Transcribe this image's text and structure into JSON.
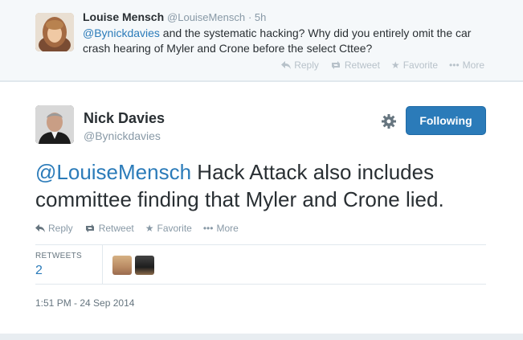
{
  "reply_tweet": {
    "name": "Louise Mensch",
    "handle": "@LouiseMensch",
    "time": "· 5h",
    "mention": "@Bynickdavies",
    "text": " and the systematic hacking? Why did you entirely omit the car crash hearing of Myler and Crone before the select Cttee?",
    "actions": {
      "reply": "Reply",
      "retweet": "Retweet",
      "favorite": "Favorite",
      "more": "More"
    }
  },
  "main_tweet": {
    "name": "Nick Davies",
    "handle": "@Bynickdavies",
    "follow_label": "Following",
    "mention": "@LouiseMensch",
    "text": " Hack Attack also includes committee finding that Myler and Crone lied.",
    "actions": {
      "reply": "Reply",
      "retweet": "Retweet",
      "favorite": "Favorite",
      "more": "More"
    },
    "stats": {
      "retweets_label": "RETWEETS",
      "retweets_count": "2"
    },
    "timestamp": "1:51 PM - 24 Sep 2014"
  },
  "icons": {
    "reply": "reply-icon",
    "retweet": "retweet-icon",
    "favorite": "star-icon",
    "more": "more-dots-icon",
    "gear": "gear-icon"
  },
  "colors": {
    "accent": "#2b7bb9",
    "follow_button": "#2b7bb9",
    "muted_text": "#8899a6",
    "background": "#f5f8fa"
  }
}
